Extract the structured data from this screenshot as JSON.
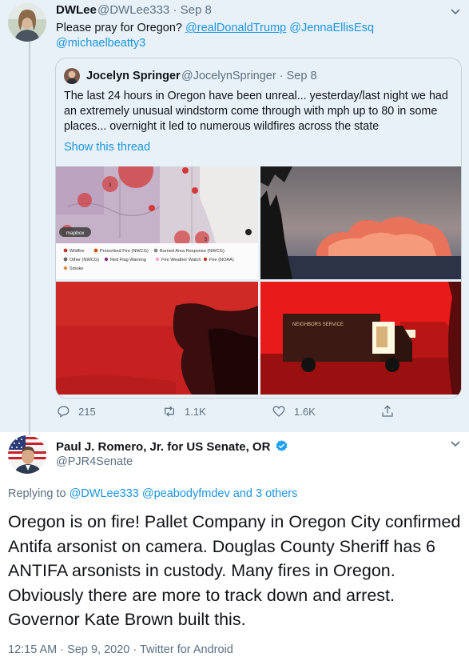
{
  "parent_tweet": {
    "name": "DWLee",
    "handle": "@DWLee333",
    "separator": "·",
    "date": "Sep 8",
    "text_plain": "Please pray for Oregon?",
    "mentions": [
      "@realDonaldTrump",
      "@JennaEllisEsq",
      "@michaelbeatty3"
    ],
    "quoted": {
      "name": "Jocelyn Springer",
      "handle": "@JocelynSpringer",
      "date": "Sep 8",
      "text": "The last 24 hours in Oregon have been unreal... yesterday/last night we had an extremely unusual windstorm come through with mph up to 80 in some places... overnight it led to numerous wildfires across the state",
      "show_thread": "Show this thread",
      "map_legend": {
        "row1": [
          "Wildfire",
          "Prescribed Fire (NWCG)",
          "Burned Area Response (NWCG)"
        ],
        "row2": [
          "Other (NWCG)",
          "Red Flag Warning",
          "Fire Weather Watch",
          "Fire (NOAA)"
        ],
        "row3": [
          "Smoke"
        ],
        "badge": "mapbox",
        "marker_labels": [
          "3",
          "5"
        ]
      },
      "photo_sign": "NEIGHBORS SERVICE"
    },
    "actions": {
      "replies": "215",
      "retweets": "1.1K",
      "likes": "1.6K"
    }
  },
  "reply_tweet": {
    "name": "Paul J. Romero, Jr. for US Senate, OR",
    "handle": "@PJR4Senate",
    "replying_prefix": "Replying to",
    "replying_to": "@DWLee333 @peabodyfmdev",
    "replying_others": "and 3 others",
    "text": "Oregon is on fire!  Pallet Company in Oregon City confirmed Antifa arsonist on camera. Douglas County Sheriff has 6 ANTIFA arsonists in custody. Many fires in Oregon. Obviously there are more to track down and arrest. Governor Kate Brown built this.",
    "meta": "12:15 AM · Sep 9, 2020 · Twitter for Android"
  },
  "colors": {
    "accent": "#1b95e0",
    "parent_bg": "#e8f1f7",
    "verified": "#1da1f2",
    "fire_red": "#d4202a"
  }
}
